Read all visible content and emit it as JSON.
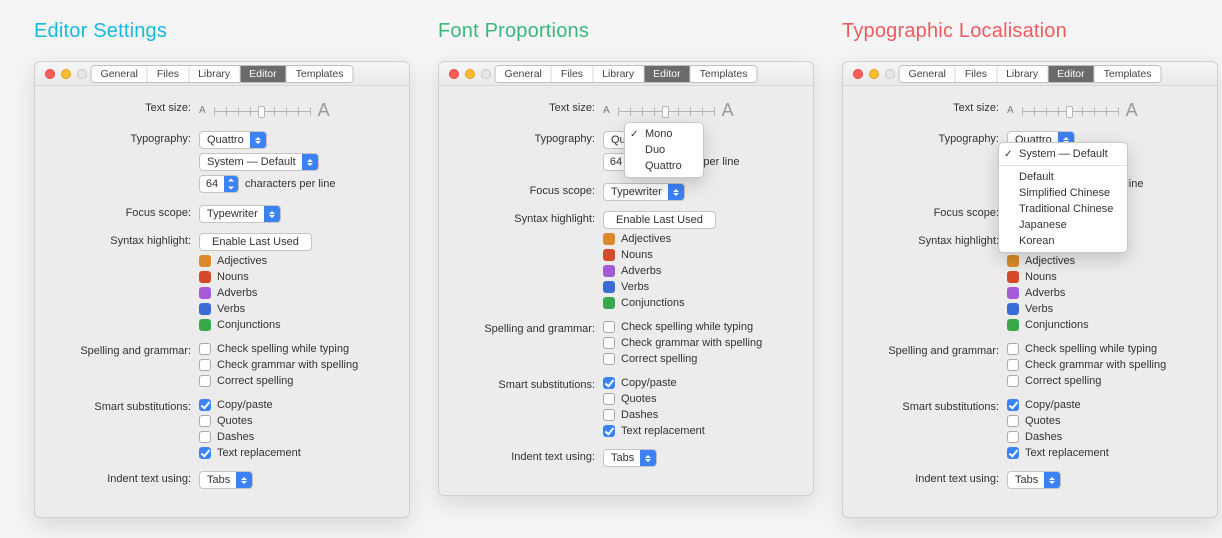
{
  "titles": {
    "col1": "Editor Settings",
    "col2": "Font Proportions",
    "col3": "Typographic Localisation"
  },
  "tabs": [
    "General",
    "Files",
    "Library",
    "Editor",
    "Templates"
  ],
  "active_tab": "Editor",
  "labels": {
    "text_size": "Text size:",
    "typography": "Typography:",
    "focus_scope": "Focus scope:",
    "syntax_highlight": "Syntax highlight:",
    "spelling_grammar": "Spelling and grammar:",
    "smart_subs": "Smart substitutions:",
    "indent": "Indent text using:",
    "cpl_suffix": "characters per line"
  },
  "values": {
    "typography": "Quattro",
    "system": "System — Default",
    "cpl": "64",
    "focus_scope": "Typewriter",
    "syntax_btn": "Enable Last Used",
    "indent": "Tabs",
    "small_a": "A",
    "big_a": "A"
  },
  "syntax": [
    {
      "label": "Adjectives",
      "color": "#d98a2a"
    },
    {
      "label": "Nouns",
      "color": "#d44a2a"
    },
    {
      "label": "Adverbs",
      "color": "#a65bd6"
    },
    {
      "label": "Verbs",
      "color": "#3a6bd6"
    },
    {
      "label": "Conjunctions",
      "color": "#3aa84a"
    }
  ],
  "spelling": [
    {
      "label": "Check spelling while typing",
      "on": false
    },
    {
      "label": "Check grammar with spelling",
      "on": false
    },
    {
      "label": "Correct spelling",
      "on": false
    }
  ],
  "subs": [
    {
      "label": "Copy/paste",
      "on": true
    },
    {
      "label": "Quotes",
      "on": false
    },
    {
      "label": "Dashes",
      "on": false
    },
    {
      "label": "Text replacement",
      "on": true
    }
  ],
  "typography_menu": [
    "Mono",
    "Duo",
    "Quattro"
  ],
  "typography_menu_selected": "Mono",
  "system_menu": [
    "System — Default",
    "Default",
    "Simplified Chinese",
    "Traditional Chinese",
    "Japanese",
    "Korean"
  ],
  "system_menu_selected": "System — Default"
}
